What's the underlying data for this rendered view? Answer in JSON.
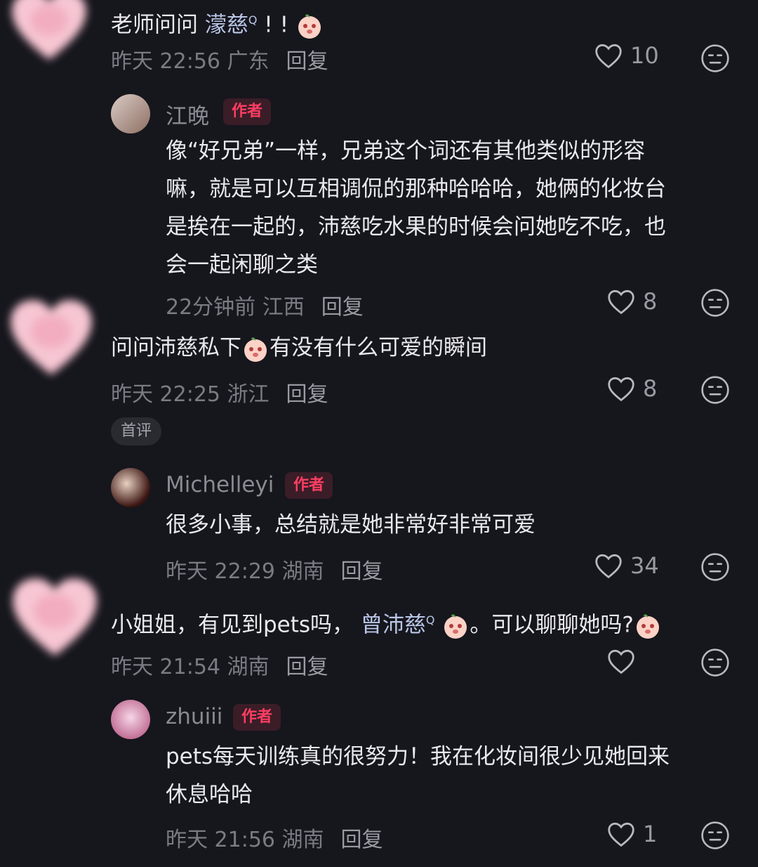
{
  "comments": [
    {
      "text_prefix": "老师问问 ",
      "mention": "濛慈",
      "text_suffix": " ! ! ",
      "time": "昨天 22:56",
      "region": "广东",
      "reply_label": "回复",
      "likes": "10"
    },
    {
      "user": "江晚",
      "badge": "作者",
      "lines": [
        "像“好兄弟”一样，兄弟这个词还有其他类似的形容",
        "嘛，就是可以互相调侃的那种哈哈哈，她俩的化妆台",
        "是挨在一起的，沛慈吃水果的时候会问她吃不吃，也",
        "会一起闲聊之类"
      ],
      "time": "22分钟前",
      "region": "江西",
      "reply_label": "回复",
      "likes": "8"
    },
    {
      "text_prefix": "问问沛慈私下",
      "text_suffix": "有没有什么可爱的瞬间",
      "time": "昨天 22:25",
      "region": "浙江",
      "reply_label": "回复",
      "likes": "8",
      "tag": "首评"
    },
    {
      "user": "Michelleyi",
      "badge": "作者",
      "text": "很多小事，总结就是她非常好非常可爱",
      "time": "昨天 22:29",
      "region": "湖南",
      "reply_label": "回复",
      "likes": "34"
    },
    {
      "text_prefix": "小姐姐，有见到pets吗，",
      "mention": "曾沛慈",
      "text_mid": "。可以聊聊她吗?",
      "time": "昨天 21:54",
      "region": "湖南",
      "reply_label": "回复",
      "likes": ""
    },
    {
      "user": "zhuiii",
      "badge": "作者",
      "lines": [
        "pets每天训练真的很努力！我在化妆间很少见她回来",
        "休息哈哈"
      ],
      "time": "昨天 21:56",
      "region": "湖南",
      "reply_label": "回复",
      "likes": "1"
    }
  ],
  "colors": {
    "background": "#16161d",
    "badge_text": "#ff3d63",
    "mention": "#b9c6e6"
  }
}
